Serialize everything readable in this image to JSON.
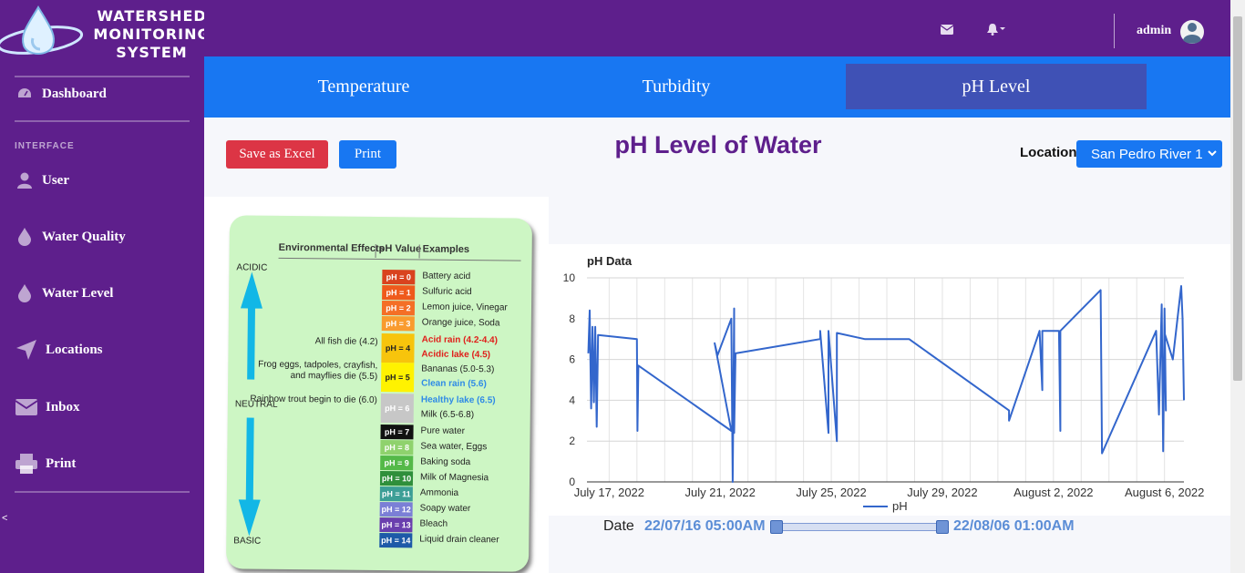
{
  "brand": {
    "lines": [
      "WATERSHED",
      "MONITORING",
      "SYSTEM"
    ],
    "logo_icon": "water-drop-logo"
  },
  "sidebar": {
    "heading": "INTERFACE",
    "toggle_label": "<",
    "items": [
      {
        "label": "Dashboard",
        "icon": "tachometer-icon"
      },
      {
        "label": "User",
        "icon": "user-icon"
      },
      {
        "label": "Water Quality",
        "icon": "drop-icon"
      },
      {
        "label": "Water Level",
        "icon": "drop-icon"
      },
      {
        "label": "Locations",
        "icon": "location-arrow-icon"
      },
      {
        "label": "Inbox",
        "icon": "envelope-icon"
      },
      {
        "label": "Print",
        "icon": "printer-icon"
      }
    ]
  },
  "topbar": {
    "user": "admin",
    "icons": [
      "envelope-icon",
      "bell-icon",
      "user-avatar-icon"
    ]
  },
  "tabs": [
    {
      "label": "Temperature",
      "active": false
    },
    {
      "label": "Turbidity",
      "active": false
    },
    {
      "label": "pH Level",
      "active": true
    }
  ],
  "toolbar": {
    "excel_label": "Save as Excel",
    "print_label": "Print"
  },
  "page_title": "pH Level of Water",
  "location": {
    "label": "Location",
    "selected": "San Pedro River 1"
  },
  "ph_scale": {
    "headers": [
      "Environmental Effects",
      "pH Value",
      "Examples"
    ],
    "side_labels": [
      "ACIDIC",
      "NEUTRAL",
      "BASIC"
    ],
    "levels": [
      {
        "ph": "pH = 0",
        "color": "#d9431e",
        "examples": [
          "Battery acid"
        ]
      },
      {
        "ph": "pH = 1",
        "color": "#ef5a1c",
        "examples": [
          "Sulfuric acid"
        ]
      },
      {
        "ph": "pH = 2",
        "color": "#f46f26",
        "examples": [
          "Lemon juice, Vinegar"
        ]
      },
      {
        "ph": "pH = 3",
        "color": "#f99b2e",
        "examples": [
          "Orange juice, Soda"
        ]
      },
      {
        "ph": "pH = 4",
        "color": "#f7c40c",
        "effect": "All fish die (4.2)",
        "examples": [
          "Acid rain (4.2-4.4)",
          "Acidic lake (4.5)"
        ]
      },
      {
        "ph": "pH = 5",
        "color": "#fff200",
        "effect": "Frog eggs, tadpoles, crayfish, and mayflies die (5.5)",
        "examples": [
          "Bananas (5.0-5.3)",
          "Clean rain (5.6)"
        ]
      },
      {
        "ph": "pH = 6",
        "color": "#c7c7c7",
        "effect": "Rainbow trout begin to die (6.0)",
        "examples": [
          "Healthy lake (6.5)",
          "Milk (6.5-6.8)"
        ]
      },
      {
        "ph": "pH = 7",
        "color": "#111111",
        "examples": [
          "Pure water"
        ]
      },
      {
        "ph": "pH = 8",
        "color": "#8fd26d",
        "examples": [
          "Sea water, Eggs"
        ]
      },
      {
        "ph": "pH = 9",
        "color": "#54b948",
        "examples": [
          "Baking soda"
        ]
      },
      {
        "ph": "pH = 10",
        "color": "#2f8f3b",
        "examples": [
          "Milk of Magnesia"
        ]
      },
      {
        "ph": "pH = 11",
        "color": "#3c9e96",
        "examples": [
          "Ammonia"
        ]
      },
      {
        "ph": "pH = 12",
        "color": "#7b7fd6",
        "examples": [
          "Soapy water"
        ]
      },
      {
        "ph": "pH = 13",
        "color": "#6a3fae",
        "examples": [
          "Bleach"
        ]
      },
      {
        "ph": "pH = 14",
        "color": "#1e5aa8",
        "examples": [
          "Liquid drain cleaner"
        ]
      }
    ]
  },
  "chart_data": {
    "type": "line",
    "title": "pH Data",
    "ylim": [
      0,
      10
    ],
    "yticks": [
      0,
      2,
      4,
      6,
      8,
      10
    ],
    "xticks": [
      "July 17, 2022",
      "July 21, 2022",
      "July 25, 2022",
      "July 29, 2022",
      "August 2, 2022",
      "August 6, 2022"
    ],
    "xrange_days": [
      16.2,
      37.7
    ],
    "grid": true,
    "legend_position": "bottom",
    "series": [
      {
        "name": "pH",
        "color": "#3366cc",
        "points": [
          [
            16.25,
            6.3
          ],
          [
            16.3,
            8.4
          ],
          [
            16.35,
            3.6
          ],
          [
            16.4,
            7.6
          ],
          [
            16.45,
            3.9
          ],
          [
            16.5,
            7.6
          ],
          [
            16.55,
            2.7
          ],
          [
            16.6,
            7.2
          ],
          [
            18.0,
            7.0
          ],
          [
            18.02,
            2.5
          ],
          [
            18.05,
            5.7
          ],
          [
            21.4,
            2.5
          ],
          [
            20.8,
            6.8
          ],
          [
            20.9,
            6.2
          ],
          [
            21.4,
            8.0
          ],
          [
            21.45,
            0.0
          ],
          [
            21.5,
            8.5
          ],
          [
            21.5,
            2.4
          ],
          [
            21.55,
            6.3
          ],
          [
            24.6,
            7.0
          ],
          [
            24.6,
            7.4
          ],
          [
            24.9,
            2.4
          ],
          [
            24.9,
            7.4
          ],
          [
            25.2,
            2.0
          ],
          [
            25.2,
            7.3
          ],
          [
            26.2,
            7.0
          ],
          [
            27.8,
            7.0
          ],
          [
            31.4,
            3.5
          ],
          [
            31.4,
            3.0
          ],
          [
            32.5,
            7.4
          ],
          [
            32.6,
            4.5
          ],
          [
            32.6,
            7.4
          ],
          [
            33.2,
            7.4
          ],
          [
            33.25,
            2.5
          ],
          [
            33.25,
            7.4
          ],
          [
            34.7,
            9.4
          ],
          [
            34.75,
            1.4
          ],
          [
            36.7,
            7.4
          ],
          [
            36.8,
            3.3
          ],
          [
            36.9,
            8.7
          ],
          [
            36.95,
            1.5
          ],
          [
            37.0,
            8.5
          ],
          [
            37.05,
            3.5
          ],
          [
            37.0,
            7.3
          ],
          [
            37.3,
            6.0
          ],
          [
            37.6,
            9.6
          ],
          [
            37.65,
            8.0
          ],
          [
            37.7,
            4.0
          ]
        ]
      }
    ]
  },
  "date_range": {
    "label": "Date",
    "start": "22/07/16 05:00AM",
    "end": "22/08/06 01:00AM"
  }
}
